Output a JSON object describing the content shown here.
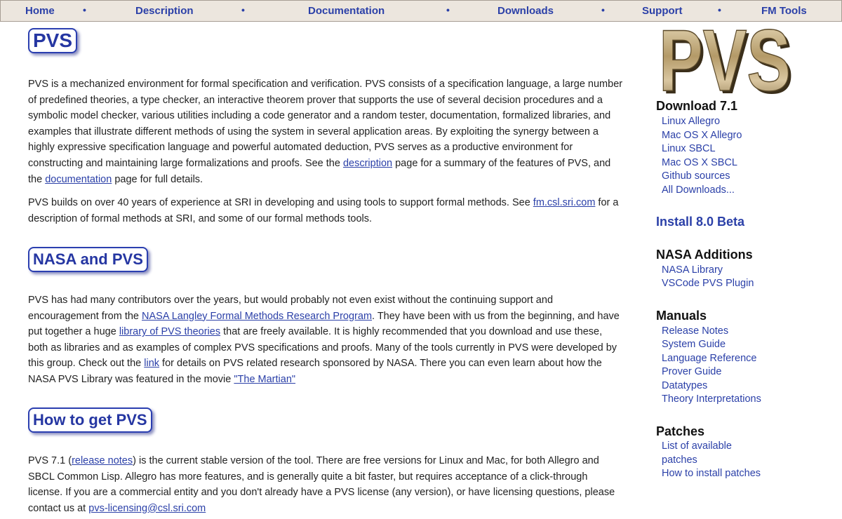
{
  "nav": {
    "items": [
      "Home",
      "Description",
      "Documentation",
      "Downloads",
      "Support",
      "FM Tools"
    ],
    "separator": "•"
  },
  "main": {
    "section1": {
      "heading": "PVS",
      "p1": {
        "t1": "PVS is a mechanized environment for formal specification and verification. PVS consists of a specification language, a large number of predefined theories, a type checker, an interactive theorem prover that supports the use of several decision procedures and a symbolic model checker, various utilities including a code generator and a random tester, documentation, formalized libraries, and examples that illustrate different methods of using the system in several application areas. By exploiting the synergy between a highly expressive specification language and powerful automated deduction, PVS serves as a productive environment for constructing and maintaining large formalizations and proofs. See the ",
        "link1": "description",
        "t2": " page for a summary of the features of PVS, and the ",
        "link2": "documentation",
        "t3": " page for full details."
      },
      "p2": {
        "t1": "PVS builds on over 40 years of experience at SRI in developing and using tools to support formal methods. See ",
        "link1": "fm.csl.sri.com",
        "t2": " for a description of formal methods at SRI, and some of our formal methods tools."
      }
    },
    "section2": {
      "heading": "NASA and PVS",
      "p1": {
        "t1": "PVS has had many contributors over the years, but would probably not even exist without the continuing support and encouragement from the ",
        "link1": "NASA Langley Formal Methods Research Program",
        "t2": ". They have been with us from the beginning, and have put together a huge ",
        "link2": "library of PVS theories",
        "t3": " that are freely available. It is highly recommended that you download and use these, both as libraries and as examples of complex PVS specifications and proofs. Many of the tools currently in PVS were developed by this group. Check out the ",
        "link3": "link",
        "t4": " for details on PVS related research sponsored by NASA. There you can even learn about how the NASA PVS Library was featured in the movie ",
        "link4": "\"The Martian\""
      }
    },
    "section3": {
      "heading": "How to get PVS",
      "p1": {
        "t1": "PVS 7.1 (",
        "link1": "release notes",
        "t2": ") is the current stable version of the tool. There are free versions for Linux and Mac, for both Allegro and SBCL Common Lisp. Allegro has more features, and is generally quite a bit faster, but requires acceptance of a click-through license. If you are a commercial entity and you don't already have a PVS license (any version), or have licensing questions, please contact us at ",
        "link2": "pvs-licensing@csl.sri.com"
      }
    }
  },
  "sidebar": {
    "logo_text": "PVS",
    "download": {
      "heading": "Download 7.1",
      "links": [
        "Linux Allegro",
        "Mac OS X Allegro",
        "Linux SBCL",
        "Mac OS X SBCL",
        "Github sources",
        "All Downloads..."
      ]
    },
    "install_beta": "Install 8.0 Beta",
    "nasa": {
      "heading": "NASA Additions",
      "links": [
        "NASA Library",
        "VSCode PVS Plugin"
      ]
    },
    "manuals": {
      "heading": "Manuals",
      "links": [
        "Release Notes",
        "System Guide",
        "Language Reference",
        "Prover Guide",
        "Datatypes",
        "Theory Interpretations"
      ]
    },
    "patches": {
      "heading": "Patches",
      "links": [
        "List of available",
        "patches",
        "How to install patches"
      ]
    }
  },
  "colors": {
    "nav_bg": "#ece6de",
    "link": "#2b40a8",
    "heading_border": "#2b3fb0",
    "logo_gold": "#b8a070"
  }
}
